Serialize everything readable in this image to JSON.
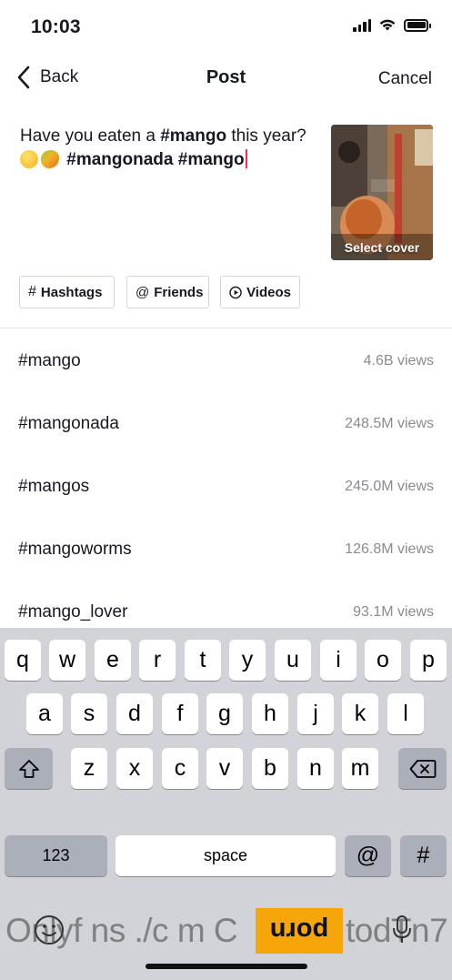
{
  "status_bar": {
    "time": "10:03"
  },
  "nav": {
    "back_label": "Back",
    "title": "Post",
    "cancel_label": "Cancel"
  },
  "caption": {
    "line1_prefix": "Have you eaten a ",
    "line1_tag": "#mango",
    "line1_suffix": " this year?",
    "line2_tags": "#mangonada #mango"
  },
  "cover": {
    "label": "Select cover"
  },
  "chips": [
    {
      "label": "Hashtags",
      "icon": "hash-icon"
    },
    {
      "label": "Friends",
      "icon": "at-icon"
    },
    {
      "label": "Videos",
      "icon": "play-circle-icon"
    }
  ],
  "suggestions": [
    {
      "tag": "#mango",
      "views": "4.6B views"
    },
    {
      "tag": "#mangonada",
      "views": "248.5M views"
    },
    {
      "tag": "#mangos",
      "views": "245.0M views"
    },
    {
      "tag": "#mangoworms",
      "views": "126.8M views"
    },
    {
      "tag": "#mango_lover",
      "views": "93.1M views"
    }
  ],
  "keyboard": {
    "row1": [
      "q",
      "w",
      "e",
      "r",
      "t",
      "y",
      "u",
      "i",
      "o",
      "p"
    ],
    "row2": [
      "a",
      "s",
      "d",
      "f",
      "g",
      "h",
      "j",
      "k",
      "l"
    ],
    "row3": [
      "z",
      "x",
      "c",
      "v",
      "b",
      "n",
      "m"
    ],
    "num_label": "123",
    "space_label": "space",
    "at_label": "@",
    "hash_label": "#"
  },
  "watermark": {
    "text": "Onlyf ns ./c m C",
    "logo_text": "porn",
    "tail_text": "todTn7"
  },
  "colors": {
    "accent": "#fe2c55",
    "muted": "#8a8b91",
    "keyboard_bg": "#d1d3d9"
  }
}
